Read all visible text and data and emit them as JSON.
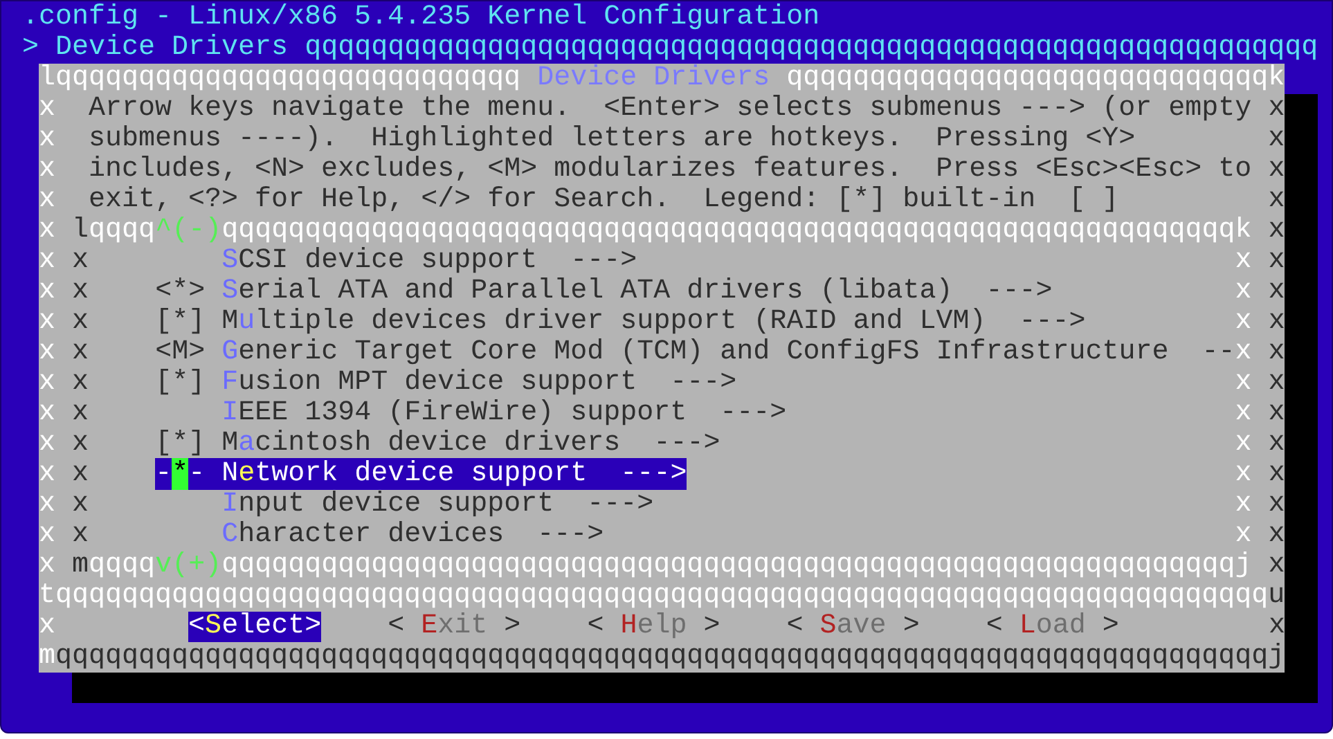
{
  "header": {
    "title": ".config - Linux/x86 5.4.235 Kernel Configuration",
    "breadcrumb": "> Device Drivers",
    "rule": "qqqqqqqqqqqqqqqqqqqqqqqqqqqqqqqqqqqqqqqqqqqqqqqqqqqqqqqqqqqqq"
  },
  "dialog": {
    "top_border": {
      "left": "lqqqqqqqqqqqqqqqqqqqqqqqqqqqq",
      "title": "Device Drivers",
      "right": "qqqqqqqqqqqqqqqqqqqqqqqqqqqqqk"
    },
    "help_lines": [
      {
        "edge_left": "x",
        "text": "Arrow keys navigate the menu.  <Enter> selects submenus ---> (or empty",
        "edge_right": "x"
      },
      {
        "edge_left": "x",
        "text": "submenus ----).  Highlighted letters are hotkeys.  Pressing <Y>",
        "edge_right": "x"
      },
      {
        "edge_left": "x",
        "text": "includes, <N> excludes, <M> modularizes features.  Press <Esc><Esc> to",
        "edge_right": "x"
      },
      {
        "edge_left": "x",
        "text": "exit, <?> for Help, </> for Search.  Legend: [*] built-in  [ ]",
        "edge_right": "x"
      }
    ],
    "menu": {
      "top_border": {
        "edge_left": "x",
        "corner": "l",
        "rule_left": "qqqq",
        "scroll_indicator": "^(-)",
        "rule_right": "qqqqqqqqqqqqqqqqqqqqqqqqqqqqqqqqqqqqqqqqqqqqqqqqqqqqqqqqqqqqqk",
        "edge_right": "x"
      },
      "items": [
        {
          "edge_left": "x",
          "inner_left": "x",
          "hotkey": "S",
          "rest": "CSI device support  --->",
          "selected": false,
          "inner_right": "x",
          "edge_right": "x"
        },
        {
          "edge_left": "x",
          "inner_left": "x",
          "prefix": "<*>",
          "hotkey": "S",
          "rest": "erial ATA and Parallel ATA drivers (libata)  --->",
          "selected": false,
          "inner_right": "x",
          "edge_right": "x"
        },
        {
          "edge_left": "x",
          "inner_left": "x",
          "prefix": "[*]",
          "lead": "M",
          "hotkey": "u",
          "rest": "ltiple devices driver support (RAID and LVM)  --->",
          "selected": false,
          "inner_right": "x",
          "edge_right": "x"
        },
        {
          "edge_left": "x",
          "inner_left": "x",
          "prefix": "<M>",
          "hotkey": "G",
          "rest": "eneric Target Core Mod (TCM) and ConfigFS Infrastructure  --",
          "selected": false,
          "inner_right": "x",
          "edge_right": "x"
        },
        {
          "edge_left": "x",
          "inner_left": "x",
          "prefix": "[*]",
          "hotkey": "F",
          "rest": "usion MPT device support  --->",
          "selected": false,
          "inner_right": "x",
          "edge_right": "x"
        },
        {
          "edge_left": "x",
          "inner_left": "x",
          "hotkey": "I",
          "rest": "EEE 1394 (FireWire) support  --->",
          "selected": false,
          "inner_right": "x",
          "edge_right": "x"
        },
        {
          "edge_left": "x",
          "inner_left": "x",
          "prefix": "[*]",
          "lead": "M",
          "hotkey": "a",
          "rest": "cintosh device drivers  --->",
          "selected": false,
          "inner_right": "x",
          "edge_right": "x"
        },
        {
          "edge_left": "x",
          "inner_left": "x",
          "prefix": "-*-",
          "lead": "N",
          "hotkey": "e",
          "rest": "twork device support  --->",
          "selected": true,
          "inner_right": "x",
          "edge_right": "x"
        },
        {
          "edge_left": "x",
          "inner_left": "x",
          "hotkey": "I",
          "rest": "nput device support  --->",
          "selected": false,
          "inner_right": "x",
          "edge_right": "x"
        },
        {
          "edge_left": "x",
          "inner_left": "x",
          "hotkey": "C",
          "rest": "haracter devices  --->",
          "selected": false,
          "inner_right": "x",
          "edge_right": "x"
        }
      ],
      "bottom_border": {
        "edge_left": "x",
        "corner": "m",
        "rule_left": "qqqq",
        "scroll_indicator": "v(+)",
        "rule_right": "qqqqqqqqqqqqqqqqqqqqqqqqqqqqqqqqqqqqqqqqqqqqqqqqqqqqqqqqqqqqqj",
        "edge_right": "x"
      }
    },
    "separator": {
      "left": "tqqqqqqqqqqqqqqqqqqqqqqqqqqqqqqqqqqqqqqqqqqqqqqqqqqqqqqqqqqqqqqqqqqqqqqqqq",
      "right": "u"
    },
    "button_row": {
      "edge_left": "x",
      "edge_right": "x"
    },
    "bottom_border": {
      "corner": "m",
      "rule": "qqqqqqqqqqqqqqqqqqqqqqqqqqqqqqqqqqqqqqqqqqqqqqqqqqqqqqqqqqqqqqqqqqqqqqqqqj"
    }
  },
  "buttons": [
    {
      "left": "<",
      "hotkey": "S",
      "rest": "elect",
      "right": ">",
      "selected": true
    },
    {
      "left": "<",
      "hotkey": "E",
      "rest": "xit",
      "right": ">",
      "selected": false
    },
    {
      "left": "<",
      "hotkey": "H",
      "rest": "elp",
      "right": ">",
      "selected": false
    },
    {
      "left": "<",
      "hotkey": "S",
      "rest": "ave",
      "right": ">",
      "selected": false
    },
    {
      "left": "<",
      "hotkey": "L",
      "rest": "oad",
      "right": ">",
      "selected": false
    }
  ]
}
